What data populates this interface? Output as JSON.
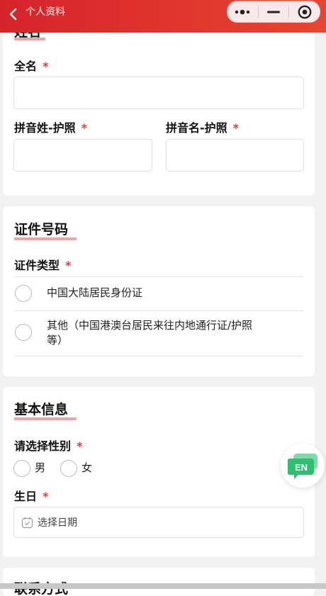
{
  "header": {
    "title": "个人资料",
    "back_icon": "chevron-left-icon",
    "capsule": {
      "more_icon": "more-dots-icon",
      "minimize_icon": "minimize-icon",
      "close_icon": "target-close-icon"
    }
  },
  "name_section": {
    "title": "姓名",
    "full_name": {
      "label": "全名",
      "required": "*",
      "value": ""
    },
    "pinyin_surname": {
      "label": "拼音姓-护照",
      "required": "*",
      "value": ""
    },
    "pinyin_given": {
      "label": "拼音名-护照",
      "required": "*",
      "value": ""
    }
  },
  "id_section": {
    "title": "证件号码",
    "type_label": "证件类型",
    "required": "*",
    "options": [
      {
        "label": "中国大陆居民身份证"
      },
      {
        "label_line1": "其他（中国港澳台居民来往内地通行证/护照",
        "label_line2": "等）"
      }
    ]
  },
  "basic_section": {
    "title": "基本信息",
    "gender_label": "请选择性别",
    "required": "*",
    "gender_options": [
      "男",
      "女"
    ],
    "birthday_label": "生日",
    "birthday_placeholder": "选择日期",
    "calendar_icon": "calendar-icon"
  },
  "contact_section": {
    "title": "联系方式"
  },
  "language_button": {
    "label": "EN",
    "icon": "chat-bubble-icon"
  },
  "colors": {
    "accent": "#d6232b",
    "required": "#e23d3d",
    "underline": "#e9a6a6",
    "en_green": "#2fbf71"
  }
}
